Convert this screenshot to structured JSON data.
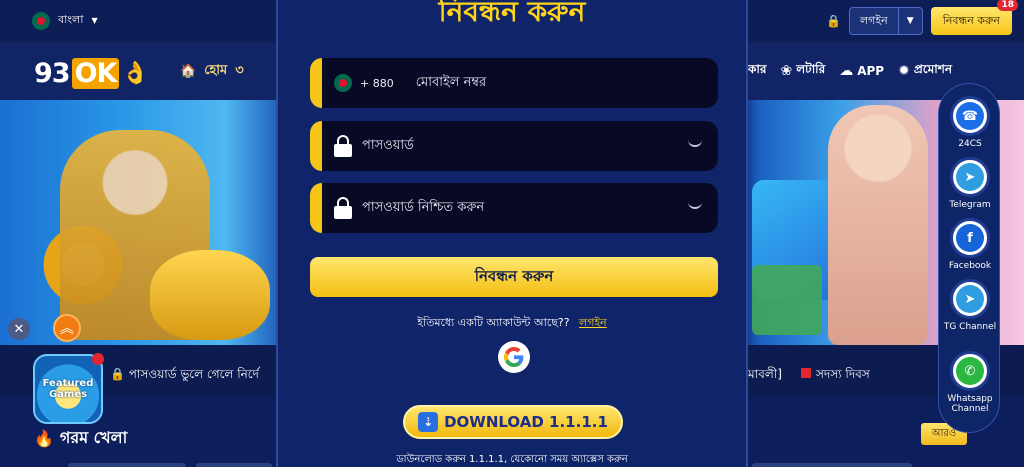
{
  "topbar": {
    "language": "বাংলা",
    "login_label": "লগইন",
    "register_label": "নিবন্ধন করুন",
    "register_badge": "18"
  },
  "nav": {
    "logo_text": "93",
    "logo_ok": "OK",
    "home": "হোম",
    "left_partial": "৩",
    "right_partial": "কার",
    "lottery": "লটারি",
    "app": "APP",
    "promotion": "প্রমোশন"
  },
  "marquee": {
    "left": "পাসওয়ার্ড ভুলে গেলে নির্দে",
    "right_a": "মাবলী]",
    "right_b": "সদস্য দিবস"
  },
  "featured": {
    "label": "Featured Games"
  },
  "hot_section": {
    "title": "গরম খেলা",
    "more_label": "আরও"
  },
  "modal": {
    "title": "নিবন্ধন করুন",
    "phone": {
      "country_code": "+ 880",
      "placeholder": "মোবাইল নম্বর"
    },
    "password": {
      "placeholder": "পাসওয়ার্ড"
    },
    "confirm_password": {
      "placeholder": "পাসওয়ার্ড নিশ্চিত করুন"
    },
    "submit_label": "নিবন্ধন করুন",
    "already_text": "ইতিমধ্যে একটি অ্যাকাউন্ট আছে??",
    "login_link": "লগইন",
    "download_label": "DOWNLOAD 1.1.1.1",
    "download_note": "ডাউনলোড করুন 1.1.1.1, যেকোনো সময় অ্যাক্সেস করুন"
  },
  "floatbar": {
    "items": [
      {
        "label": "24CS",
        "icon": "headset-icon",
        "color": "#1d6fe8"
      },
      {
        "label": "Telegram",
        "icon": "telegram-icon",
        "color": "#2f9ee0"
      },
      {
        "label": "Facebook",
        "icon": "facebook-icon",
        "color": "#1565d8"
      },
      {
        "label": "TG Channel",
        "icon": "telegram-icon",
        "color": "#2f9ee0"
      },
      {
        "label": "Whatsapp Channel",
        "icon": "whatsapp-icon",
        "color": "#2bb741"
      }
    ]
  },
  "colors": {
    "accent": "#f5c518",
    "background": "#0c1e5c",
    "modal": "#0f2469"
  }
}
